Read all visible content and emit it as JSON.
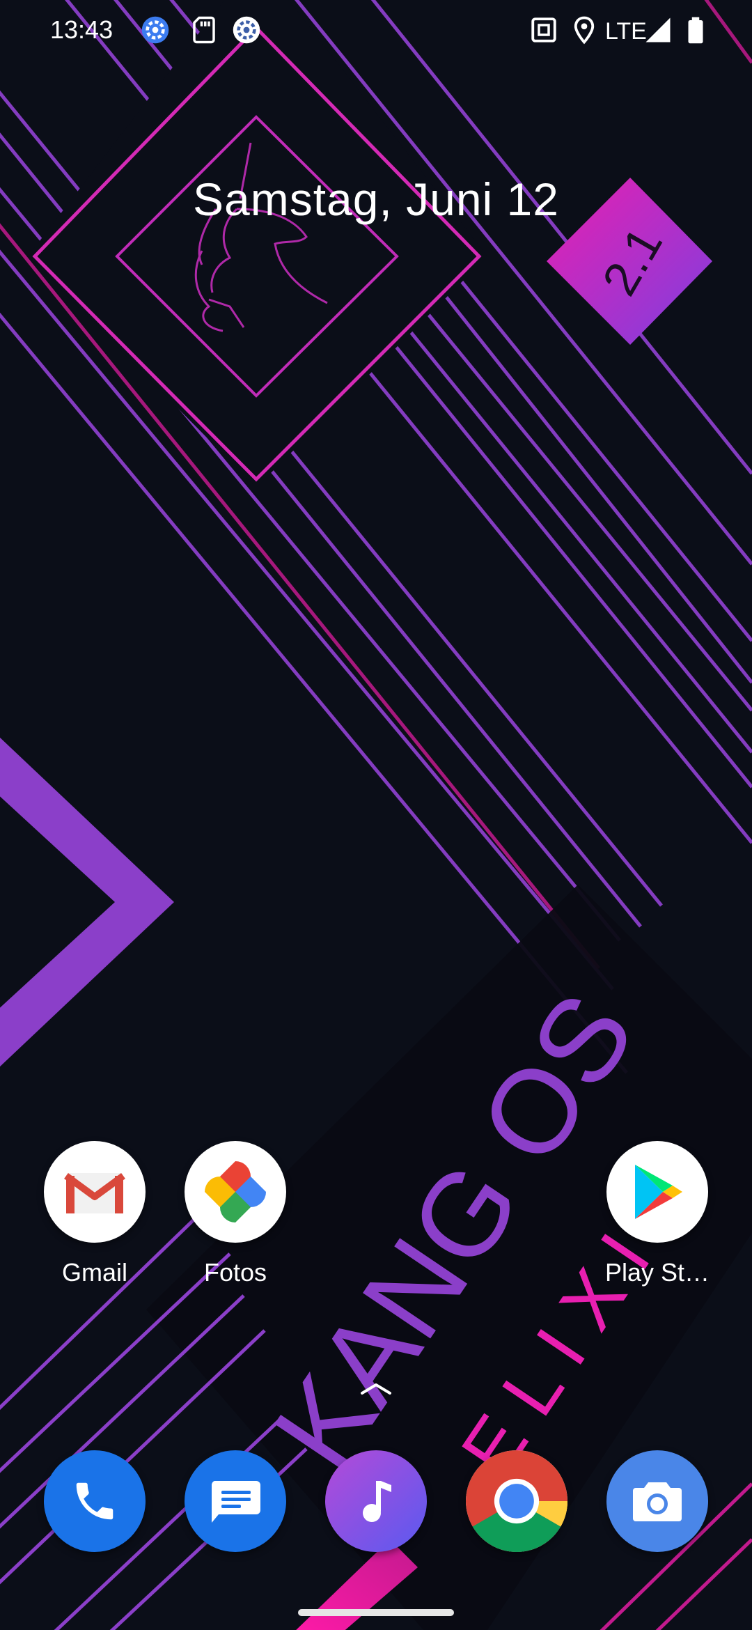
{
  "status_bar": {
    "time": "13:43",
    "network": "LTE",
    "left_icons": [
      "settings-gear-icon",
      "sd-card-icon",
      "settings-gear-icon"
    ],
    "right_icons": [
      "nfc-icon",
      "location-icon",
      "signal-icon",
      "battery-icon"
    ]
  },
  "wallpaper": {
    "badge_text": "2.1",
    "brand_text": "KANG OS",
    "sub_text": "E L I X I R",
    "colors": {
      "background": "#0b0e18",
      "purple": "#8b3fc9",
      "pink": "#e81fb0"
    }
  },
  "date_widget": {
    "text": "Samstag, Juni 12"
  },
  "home_apps": [
    {
      "label": "Gmail",
      "icon": "gmail-icon"
    },
    {
      "label": "Fotos",
      "icon": "google-photos-icon"
    },
    {
      "label": "Play St…",
      "icon": "play-store-icon"
    }
  ],
  "dock_apps": [
    {
      "icon": "phone-icon",
      "color": "#1a73e8"
    },
    {
      "icon": "messages-icon",
      "color": "#1a73e8"
    },
    {
      "icon": "music-icon",
      "color": "#7b4de8"
    },
    {
      "icon": "chrome-icon",
      "color": "#4285f4"
    },
    {
      "icon": "camera-icon",
      "color": "#4a86e8"
    }
  ]
}
